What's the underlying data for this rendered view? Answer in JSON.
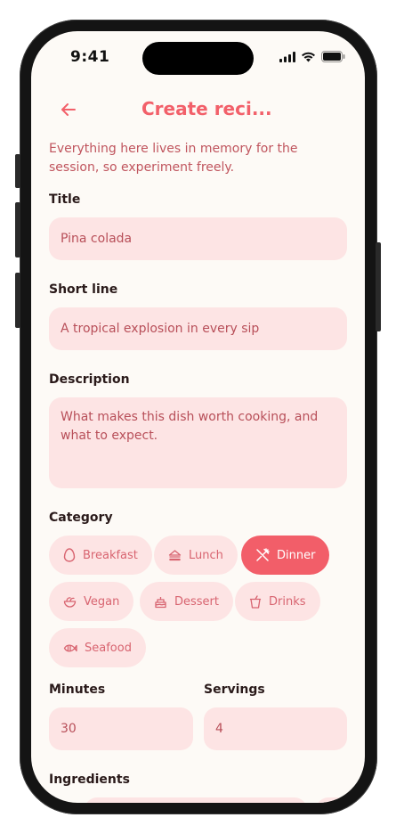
{
  "status": {
    "time": "9:41"
  },
  "header": {
    "title": "Create reci..."
  },
  "intro": "Everything here lives in memory for the session, so experiment freely.",
  "form": {
    "title_label": "Title",
    "title_value": "Pina colada",
    "short_label": "Short line",
    "short_value": "A tropical explosion in every sip",
    "description_label": "Description",
    "description_placeholder": "What makes this dish worth cooking, and what to expect.",
    "category_label": "Category",
    "categories": [
      {
        "label": "Breakfast",
        "icon": "egg-icon",
        "selected": false
      },
      {
        "label": "Lunch",
        "icon": "sandwich-icon",
        "selected": false
      },
      {
        "label": "Dinner",
        "icon": "utensils-crossed-icon",
        "selected": true
      },
      {
        "label": "Vegan",
        "icon": "salad-icon",
        "selected": false
      },
      {
        "label": "Dessert",
        "icon": "cake-icon",
        "selected": false
      },
      {
        "label": "Drinks",
        "icon": "cup-icon",
        "selected": false
      },
      {
        "label": "Seafood",
        "icon": "fish-icon",
        "selected": false
      }
    ],
    "minutes_label": "Minutes",
    "minutes_value": "30",
    "servings_label": "Servings",
    "servings_value": "4",
    "ingredients_label": "Ingredients"
  },
  "colors": {
    "accent": "#f25e69",
    "field_bg": "#fde4e4",
    "screen_bg": "#fdfaf6"
  }
}
